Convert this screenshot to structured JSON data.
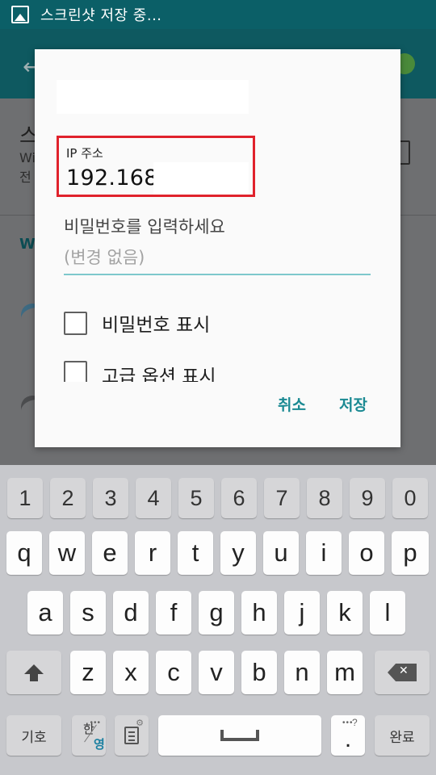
{
  "status_bar": {
    "text": "스크린샷 저장 중..."
  },
  "dialog": {
    "ip_label": "IP 주소",
    "ip_value": "192.168.",
    "password_label": "비밀번호를 입력하세요",
    "password_placeholder": "(변경 없음)",
    "show_password_label": "비밀번호 표시",
    "advanced_options_label": "고급 옵션 표시",
    "cancel_label": "취소",
    "save_label": "저장"
  },
  "keyboard": {
    "number_row": [
      "1",
      "2",
      "3",
      "4",
      "5",
      "6",
      "7",
      "8",
      "9",
      "0"
    ],
    "row1": [
      "q",
      "w",
      "e",
      "r",
      "t",
      "y",
      "u",
      "i",
      "o",
      "p"
    ],
    "row2": [
      "a",
      "s",
      "d",
      "f",
      "g",
      "h",
      "j",
      "k",
      "l"
    ],
    "row3": [
      "z",
      "x",
      "c",
      "v",
      "b",
      "n",
      "m"
    ],
    "symbols_label": "기호",
    "lang_top": "한",
    "lang_bottom": "영",
    "done_label": "완료",
    "period_label": ".",
    "period_top": "?"
  }
}
